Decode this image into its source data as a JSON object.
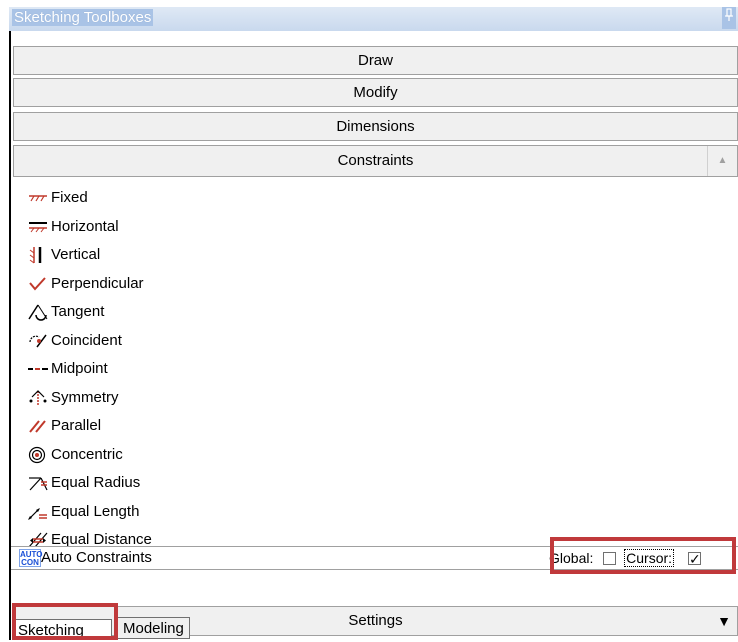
{
  "window": {
    "title": "Sketching Toolboxes",
    "pin_glyph": "ᵖ"
  },
  "sections": {
    "draw": "Draw",
    "modify": "Modify",
    "dimensions": "Dimensions",
    "constraints": "Constraints",
    "settings": "Settings"
  },
  "constraints": [
    {
      "label": "Fixed",
      "icon": "fixed-icon"
    },
    {
      "label": "Horizontal",
      "icon": "horizontal-icon"
    },
    {
      "label": "Vertical",
      "icon": "vertical-icon"
    },
    {
      "label": "Perpendicular",
      "icon": "perpendicular-icon"
    },
    {
      "label": "Tangent",
      "icon": "tangent-icon"
    },
    {
      "label": "Coincident",
      "icon": "coincident-icon"
    },
    {
      "label": "Midpoint",
      "icon": "midpoint-icon"
    },
    {
      "label": "Symmetry",
      "icon": "symmetry-icon"
    },
    {
      "label": "Parallel",
      "icon": "parallel-icon"
    },
    {
      "label": "Concentric",
      "icon": "concentric-icon"
    },
    {
      "label": "Equal Radius",
      "icon": "equal-radius-icon"
    },
    {
      "label": "Equal Length",
      "icon": "equal-length-icon"
    },
    {
      "label": "Equal Distance",
      "icon": "equal-distance-icon"
    }
  ],
  "auto_constraints": {
    "label": "Auto Constraints",
    "icon_text_top": "AUTO",
    "icon_text_bottom": "CON",
    "global_label": "Global:",
    "global_checked": false,
    "cursor_label": "Cursor:",
    "cursor_checked": true
  },
  "tabs": [
    {
      "label": "Sketching",
      "active": true
    },
    {
      "label": "Modeling",
      "active": false
    }
  ],
  "colors": {
    "highlight_box": "#c0393b",
    "title_bar": "#a9c3e6",
    "icon_red": "#c0392b"
  }
}
